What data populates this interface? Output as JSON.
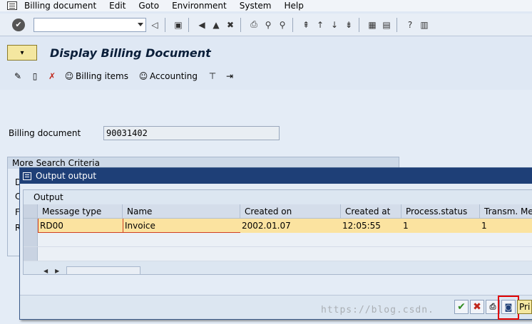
{
  "menubar": {
    "items": [
      {
        "label": "Billing document"
      },
      {
        "label": "Edit"
      },
      {
        "label": "Goto"
      },
      {
        "label": "Environment"
      },
      {
        "label": "System"
      },
      {
        "label": "Help"
      }
    ]
  },
  "toolbar": {
    "command_field": "",
    "enter_icon": "checkmark-circle-icon"
  },
  "page": {
    "title": "Display Billing Document",
    "app_toolbar": {
      "billing_items": "Billing items",
      "accounting": "Accounting"
    },
    "billing_document_label": "Billing document",
    "billing_document_value": "90031402",
    "search_group_title": "More Search Criteria",
    "search_group_letters": [
      "D",
      "C",
      "F",
      "R"
    ]
  },
  "dialog": {
    "title": "Output output",
    "group_title": "Output",
    "columns": [
      "Message type",
      "Name",
      "Created on",
      "Created at",
      "Process.status",
      "Transm. Medi"
    ],
    "rows": [
      {
        "message_type": "RD00",
        "name": "Invoice",
        "created_on": "2002.01.07",
        "created_at": "12:05:55",
        "process_status": "1",
        "transm_medium": "1"
      }
    ],
    "footer": {
      "preview_label": "Pri"
    }
  },
  "watermark": "https://blog.csdn."
}
